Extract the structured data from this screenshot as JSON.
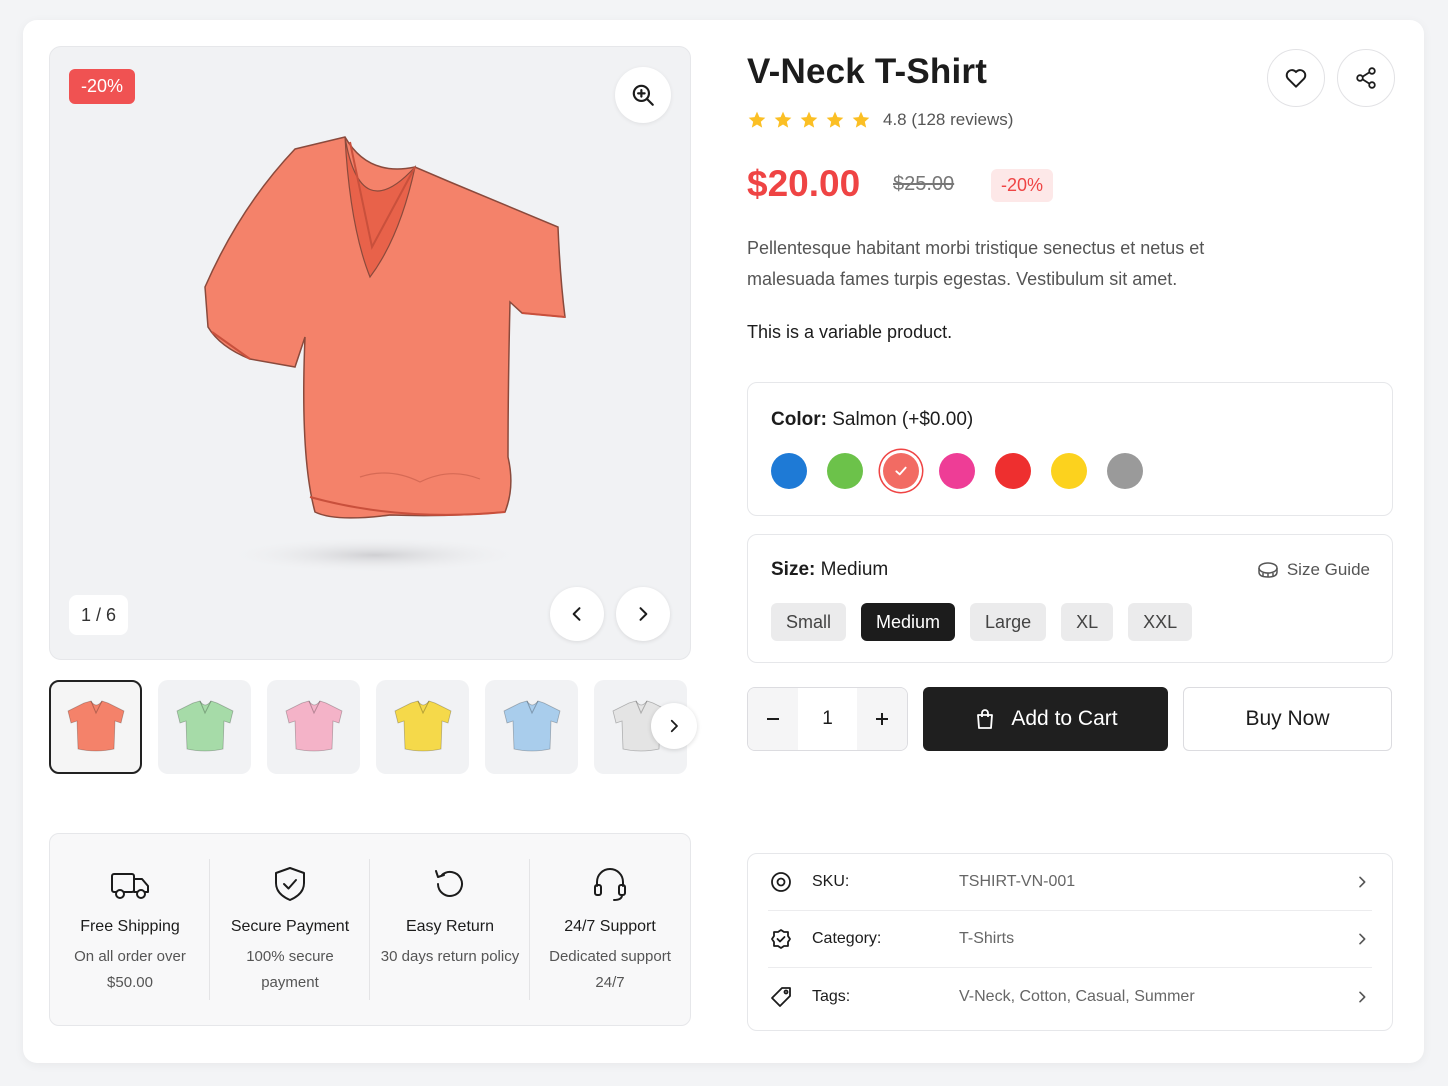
{
  "gallery": {
    "discount_badge": "-20%",
    "counter": "1 / 6",
    "thumbnails": [
      {
        "color": "#f4826a",
        "active": true
      },
      {
        "color": "#a6dba8",
        "active": false
      },
      {
        "color": "#f4b3c8",
        "active": false
      },
      {
        "color": "#f5d94a",
        "active": false
      },
      {
        "color": "#a9cdec",
        "active": false
      },
      {
        "color": "#e4e4e4",
        "active": false
      }
    ]
  },
  "features": [
    {
      "icon": "truck-icon",
      "title": "Free Shipping",
      "subtitle": "On all order over $50.00"
    },
    {
      "icon": "shield-check-icon",
      "title": "Secure Payment",
      "subtitle": "100% secure payment"
    },
    {
      "icon": "return-icon",
      "title": "Easy Return",
      "subtitle": "30 days return policy"
    },
    {
      "icon": "headset-icon",
      "title": "24/7 Support",
      "subtitle": "Dedicated support 24/7"
    }
  ],
  "product": {
    "title": "V-Neck T-Shirt",
    "rating": 4.8,
    "rating_text": "4.8 (128 reviews)",
    "price": "$20.00",
    "old_price": "$25.00",
    "discount": "-20%",
    "description": "Pellentesque habitant morbi tristique senectus et netus et malesuada fames turpis egestas. Vestibulum sit amet.",
    "variable_note": "This is a variable product."
  },
  "color": {
    "label": "Color:",
    "value": "Salmon (+$0.00)",
    "swatches": [
      {
        "name": "blue",
        "hex": "#1e7ad6"
      },
      {
        "name": "green",
        "hex": "#6cc24a"
      },
      {
        "name": "salmon",
        "hex": "#f26b63",
        "selected": true
      },
      {
        "name": "pink",
        "hex": "#ee3d96"
      },
      {
        "name": "red",
        "hex": "#ee2f2f"
      },
      {
        "name": "yellow",
        "hex": "#fcd21e"
      },
      {
        "name": "gray",
        "hex": "#9a9a9a"
      }
    ]
  },
  "size": {
    "label": "Size:",
    "value": "Medium",
    "guide_label": "Size Guide",
    "options": [
      "Small",
      "Medium",
      "Large",
      "XL",
      "XXL"
    ],
    "selected": "Medium"
  },
  "purchase": {
    "quantity": "1",
    "add_to_cart": "Add to Cart",
    "buy_now": "Buy Now"
  },
  "meta": [
    {
      "icon": "sku-icon",
      "label": "SKU:",
      "value": "TSHIRT-VN-001"
    },
    {
      "icon": "category-icon",
      "label": "Category:",
      "value": "T-Shirts"
    },
    {
      "icon": "tag-icon",
      "label": "Tags:",
      "value": "V-Neck, Cotton, Casual, Summer"
    }
  ],
  "colors": {
    "accent": "#ef4444",
    "dark": "#1f1f1f",
    "star": "#fbbf24"
  }
}
